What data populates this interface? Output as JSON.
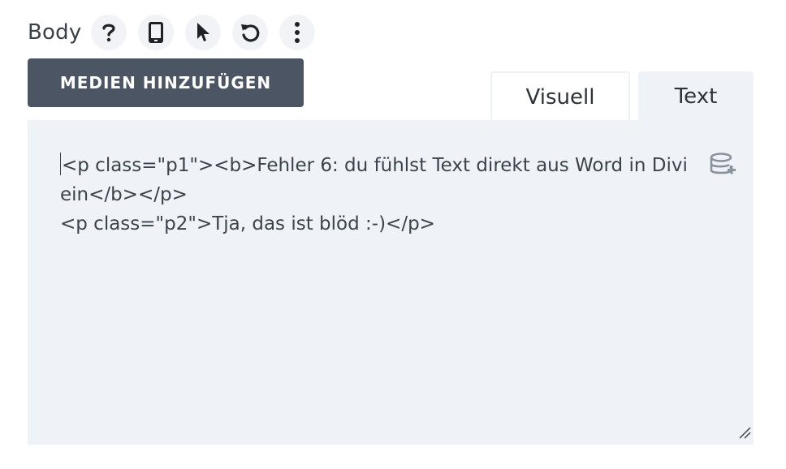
{
  "field": {
    "label": "Body"
  },
  "toolbar": {
    "icons": [
      "help-icon",
      "mobile-icon",
      "pointer-icon",
      "undo-icon",
      "more-vertical-icon"
    ]
  },
  "media_button": {
    "label": "MEDIEN HINZUFÜGEN"
  },
  "tabs": [
    {
      "label": "Visuell",
      "active": false
    },
    {
      "label": "Text",
      "active": true
    }
  ],
  "editor": {
    "lines": [
      "<p class=\"p1\"><b>Fehler 6: du fühlst Text direkt aus Word in Divi",
      "ein</b></p>",
      "<p class=\"p2\">Tja, das ist blöd :-)</p>"
    ]
  },
  "colors": {
    "button_bg": "#4b5563",
    "editor_bg": "#eff2f7",
    "icon_bg": "#f1f3f6"
  }
}
